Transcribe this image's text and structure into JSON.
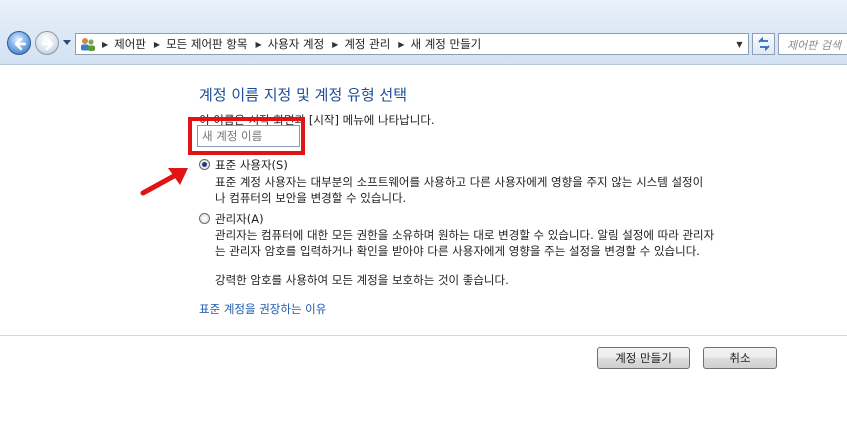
{
  "address_bar": {
    "breadcrumbs": [
      "제어판",
      "모든 제어판 항목",
      "사용자 계정",
      "계정 관리",
      "새 계정 만들기"
    ],
    "search_placeholder": "제어판 검색"
  },
  "page": {
    "title": "계정 이름 지정 및 계정 유형 선택",
    "description": "이 이름은 시작 화면과 [시작] 메뉴에 나타납니다.",
    "name_input": {
      "value": "",
      "placeholder": "새 계정 이름"
    },
    "options": [
      {
        "label": "표준 사용자(S)",
        "checked": true,
        "description": [
          "표준 계정 사용자는 대부분의 소프트웨어를 사용하고 다른 사용자에게 영향을 주지 않는 시스템 설정이",
          "나 컴퓨터의 보안을 변경할 수 있습니다."
        ]
      },
      {
        "label": "관리자(A)",
        "checked": false,
        "description": [
          "관리자는 컴퓨터에 대한 모든 권한을 소유하며 원하는 대로 변경할 수 있습니다. 알림 설정에 따라 관리자",
          "는 관리자 암호를 입력하거나 확인을 받아야 다른 사용자에게 영향을 주는 설정을 변경할 수 있습니다."
        ]
      }
    ],
    "password_note": "강력한 암호를 사용하여 모든 계정을 보호하는 것이 좋습니다.",
    "help_link": "표준 계정을 권장하는 이유"
  },
  "buttons": {
    "create": "계정 만들기",
    "cancel": "취소"
  },
  "annotation": {
    "highlight_color": "#e01414"
  },
  "icons": {
    "back": "back-arrow-icon",
    "forward": "forward-arrow-icon",
    "location": "users-control-panel-icon",
    "refresh": "refresh-icon"
  }
}
